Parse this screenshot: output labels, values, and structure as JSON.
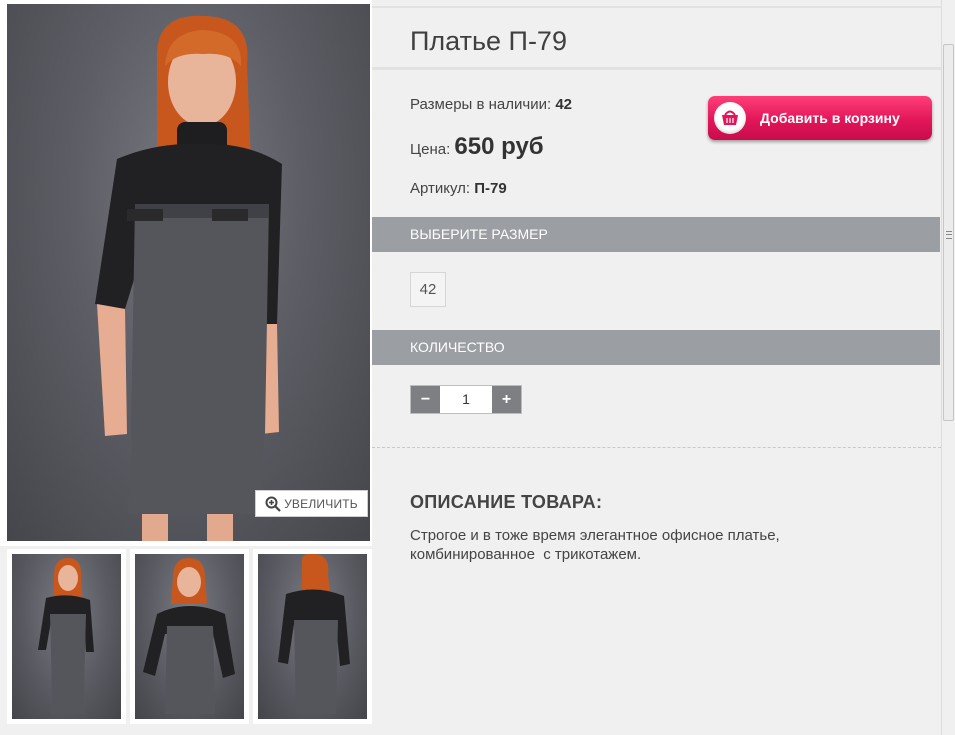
{
  "product": {
    "title": "Платье П-79",
    "sizes_label": "Размеры в наличии:",
    "sizes_value": "42",
    "price_label": "Цена:",
    "price_value": "650 руб",
    "article_label": "Артикул:",
    "article_value": "П-79"
  },
  "cart_button": {
    "label": "Добавить в корзину",
    "icon": "basket-icon",
    "color": "#e21659"
  },
  "zoom_button": {
    "label": "УВЕЛИЧИТЬ",
    "icon": "zoom-in-icon"
  },
  "size_section": {
    "heading": "ВЫБЕРИТЕ РАЗМЕР",
    "options": [
      "42"
    ]
  },
  "quantity_section": {
    "heading": "КОЛИЧЕСТВО",
    "minus": "−",
    "value": "1",
    "plus": "+"
  },
  "description": {
    "heading": "ОПИСАНИЕ ТОВАРА:",
    "text": "Строгое и в тоже время элегантное офисное платье,\nкомбинированное  с трикотажем."
  },
  "thumbnails": [
    "front-view",
    "front-pose-view",
    "back-view"
  ],
  "colors": {
    "band": "#9b9ea3",
    "accent": "#e21659",
    "background": "#f0f0f0"
  }
}
